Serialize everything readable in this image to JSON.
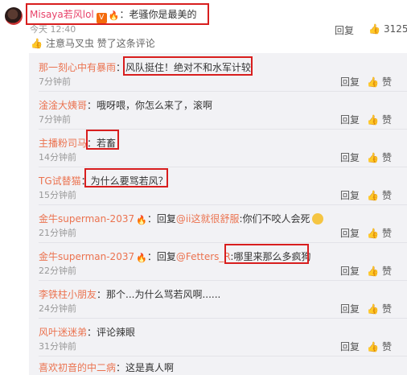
{
  "main_comment": {
    "username": "Misaya若风lol",
    "vip_badge": "V",
    "fire_icon": "fire-level-icon",
    "separator": "：",
    "text": "老骚你是最美的",
    "time": "今天 12:40",
    "reply_label": "回复",
    "like_count": "3125",
    "liked_by_name": "注意马叉虫",
    "liked_by_suffix": " 赞了这条评论"
  },
  "replies": [
    {
      "user": "那一刻心中有暴雨",
      "fire": false,
      "body": "：风队挺住！绝对不和水军计较",
      "mention": "",
      "tail": "",
      "time": "7分钟前"
    },
    {
      "user": "淦淦大姨哥",
      "fire": false,
      "body": "：哦呀喂，你怎么来了，滚啊",
      "mention": "",
      "tail": "",
      "time": "7分钟前"
    },
    {
      "user": "主播粉司马",
      "fire": false,
      "body": "：若畜",
      "mention": "",
      "tail": "",
      "time": "14分钟前"
    },
    {
      "user": "TG试替猫",
      "fire": false,
      "body": "：为什么要骂若风？",
      "mention": "",
      "tail": "",
      "time": "15分钟前"
    },
    {
      "user": "金牛superman-2037",
      "fire": true,
      "body": "：回复",
      "mention": "@ii这就很舒服",
      "tail": ":你们不咬人会死",
      "time": "21分钟前"
    },
    {
      "user": "金牛superman-2037",
      "fire": true,
      "body": "：回复",
      "mention": "@Fetters_R",
      "tail": ":哪里来那么多疯狗",
      "time": "22分钟前"
    },
    {
      "user": "李铁柱小朋友",
      "fire": false,
      "body": "：那个...为什么骂若风啊......",
      "mention": "",
      "tail": "",
      "time": "24分钟前"
    },
    {
      "user": "风叶迷迷弟",
      "fire": false,
      "body": "：评论辣眼",
      "mention": "",
      "tail": "",
      "time": "31分钟前"
    },
    {
      "user": "喜欢初音的中二病",
      "fire": false,
      "body": "：这是真人啊",
      "mention": "",
      "tail": "",
      "time": ""
    }
  ],
  "reply_label": "回复",
  "like_label": "赞",
  "colors": {
    "username_link": "#eb7350",
    "main_name": "#e8436a",
    "highlight_box": "#d81e1e",
    "sub_bg": "#f2f2f5"
  }
}
